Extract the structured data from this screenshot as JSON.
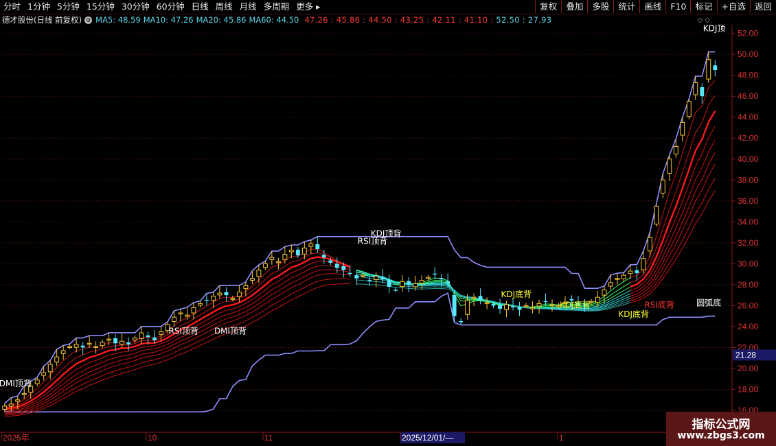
{
  "toolbar": {
    "periods": [
      "分时",
      "1分钟",
      "5分钟",
      "15分钟",
      "30分钟",
      "60分钟",
      "日线",
      "周线",
      "月线",
      "多周期",
      "更多"
    ],
    "active_period": "日线",
    "right_buttons": [
      "复权",
      "叠加",
      "多股",
      "统计",
      "画线",
      "F10",
      "标记",
      "+自选",
      "返回"
    ]
  },
  "info": {
    "stock_title": "德才股份(日线 前复权)",
    "ma5": "MA5: 48.59",
    "ma10": "MA10: 47.26",
    "ma20": "MA20: 45.86",
    "ma60": "MA60: 44.50",
    "indicator_values": "47.26 : 45.86 : 44.50 : 43.25 : 42.11 : 41.10 :",
    "indicator_tail": "52.50 : 27.93",
    "corner_icons": "◇ ◇"
  },
  "axis": {
    "y_ticks": [
      "52.00",
      "50.00",
      "48.00",
      "46.00",
      "44.00",
      "42.00",
      "40.00",
      "38.00",
      "36.00",
      "34.00",
      "32.00",
      "30.00",
      "28.00",
      "26.00",
      "24.00",
      "22.00",
      "20.00",
      "18.00",
      "16.00"
    ],
    "current_price_tag": "21.28",
    "x_labels": [
      "2025年",
      "10",
      "11",
      "2025/12/01/—",
      "1"
    ]
  },
  "signals": [
    {
      "text": "DMI顶背",
      "color": "#ffffff"
    },
    {
      "text": "RSI顶背",
      "color": "#ffffff"
    },
    {
      "text": "DMI顶背",
      "color": "#ffffff"
    },
    {
      "text": "RSI顶背",
      "color": "#ffffff"
    },
    {
      "text": "KDJ顶背",
      "color": "#ffffff"
    },
    {
      "text": "KDJ底背",
      "color": "#ffff33"
    },
    {
      "text": "KDJ底背",
      "color": "#ffff33"
    },
    {
      "text": "KDJ底背",
      "color": "#ffff33"
    },
    {
      "text": "RSI底背",
      "color": "#ff3333"
    },
    {
      "text": "圆弧底",
      "color": "#ffffff"
    },
    {
      "text": "KDJ顶",
      "color": "#ffffff"
    }
  ],
  "watermark": {
    "title": "指标公式网",
    "url": "www.zbgs3.com"
  },
  "chart_data": {
    "type": "candlestick",
    "ylim": [
      16,
      52.5
    ],
    "candle_count": 110,
    "closes": [
      16.4,
      16.6,
      17.0,
      17.6,
      18.3,
      18.9,
      19.6,
      20.4,
      21.1,
      21.7,
      22.1,
      22.3,
      22.0,
      22.4,
      22.1,
      22.5,
      22.8,
      22.4,
      22.6,
      22.3,
      22.9,
      23.4,
      23.0,
      22.7,
      23.5,
      24.2,
      24.9,
      25.3,
      25.1,
      25.8,
      26.2,
      26.5,
      26.9,
      27.2,
      27.0,
      26.7,
      27.3,
      27.9,
      28.6,
      29.4,
      30.0,
      30.6,
      30.2,
      30.9,
      31.3,
      30.8,
      31.5,
      31.9,
      31.4,
      30.6,
      30.1,
      29.6,
      29.4,
      29.1,
      28.6,
      28.9,
      28.4,
      28.8,
      28.5,
      27.8,
      27.5,
      28.3,
      28.0,
      28.1,
      28.4,
      28.7,
      29.0,
      28.5,
      28.1,
      25.0,
      24.4,
      26.5,
      26.8,
      26.5,
      26.3,
      26.0,
      25.7,
      26.1,
      25.9,
      25.6,
      26.0,
      25.8,
      26.2,
      26.4,
      26.1,
      26.0,
      26.3,
      26.5,
      26.2,
      26.0,
      26.4,
      26.8,
      27.5,
      28.2,
      28.6,
      28.9,
      29.3,
      29.1,
      30.5,
      32.5,
      35.5,
      38.0,
      40.0,
      41.2,
      43.5,
      45.5,
      47.3,
      46.0,
      49.5,
      48.5
    ],
    "ma_ribbon_levels": 9,
    "channel_upper": "stepped ceiling following recent highs",
    "channel_lower": "stepped floor following recent lows"
  }
}
